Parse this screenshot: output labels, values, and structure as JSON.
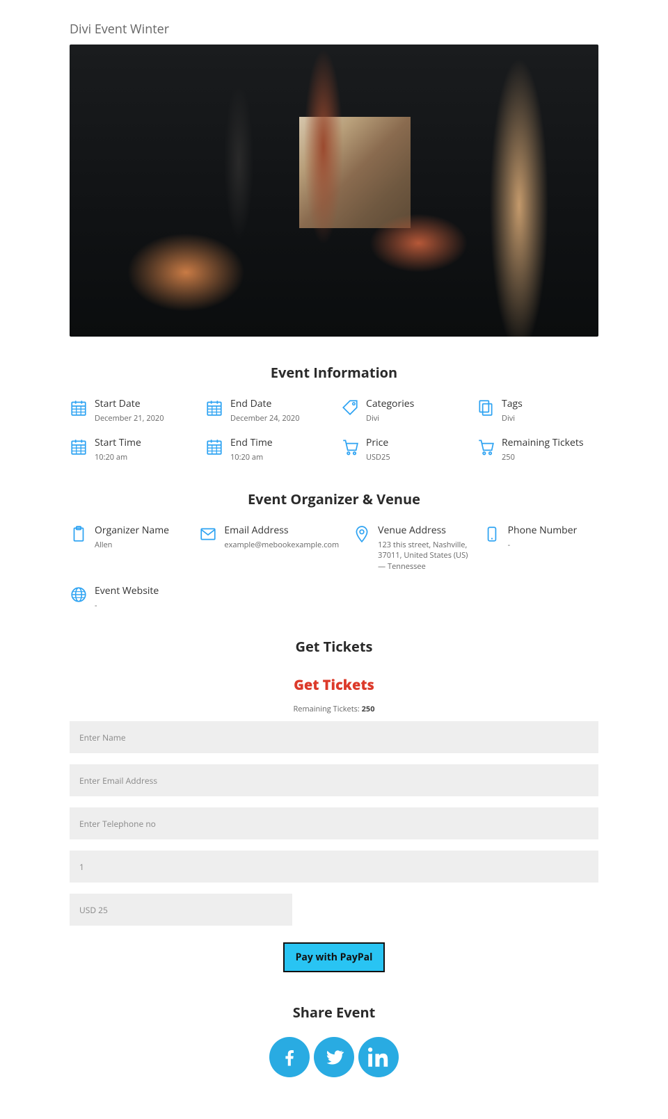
{
  "page_title": "Divi Event Winter",
  "sections": {
    "info": "Event Information",
    "org": "Event Organizer & Venue",
    "tickets": "Get Tickets",
    "share": "Share Event"
  },
  "info": {
    "start_date": {
      "label": "Start Date",
      "value": "December 21, 2020"
    },
    "end_date": {
      "label": "End Date",
      "value": "December 24, 2020"
    },
    "categories": {
      "label": "Categories",
      "value": "Divi"
    },
    "tags": {
      "label": "Tags",
      "value": "Divi"
    },
    "start_time": {
      "label": "Start Time",
      "value": "10:20 am"
    },
    "end_time": {
      "label": "End Time",
      "value": "10:20 am"
    },
    "price": {
      "label": "Price",
      "value": "USD25"
    },
    "remaining": {
      "label": "Remaining Tickets",
      "value": "250"
    }
  },
  "org": {
    "name": {
      "label": "Organizer Name",
      "value": "Allen"
    },
    "email": {
      "label": "Email Address",
      "value": "example@mebookexample.com"
    },
    "address": {
      "label": "Venue Address",
      "value": "123 this street, Nashville, 37011, United States (US) — Tennessee"
    },
    "phone": {
      "label": "Phone Number",
      "value": "-"
    },
    "website": {
      "label": "Event Website",
      "value": "-"
    }
  },
  "tickets": {
    "subtitle": "Get Tickets",
    "remaining_label": "Remaining Tickets: ",
    "remaining_value": "250",
    "placeholders": {
      "name": "Enter Name",
      "email": "Enter Email Address",
      "tel": "Enter Telephone no",
      "qty": "1",
      "price": "USD 25"
    },
    "button": "Pay with PayPal"
  },
  "share": {
    "facebook": "facebook-icon",
    "twitter": "twitter-icon",
    "linkedin": "linkedin-icon"
  }
}
